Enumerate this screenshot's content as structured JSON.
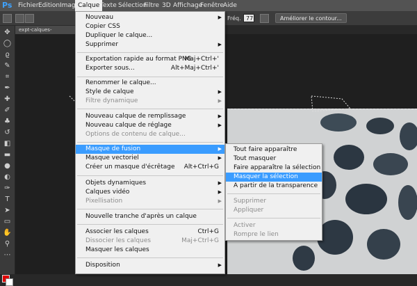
{
  "app": {
    "logo": "Ps"
  },
  "menubar": {
    "items": [
      "Fichier",
      "Edition",
      "Image",
      "Calque",
      "Texte",
      "Sélection",
      "Filtre",
      "3D",
      "Affichage",
      "Fenêtre",
      "Aide"
    ],
    "active": "Calque"
  },
  "options_bar": {
    "freq_label": "Fréq. :",
    "freq_value": "77",
    "refine_button": "Améliorer le contour..."
  },
  "document": {
    "tab_title": "expt-calques-arrivee.psd @"
  },
  "calque_menu": {
    "items": [
      {
        "label": "Nouveau",
        "shortcut": "",
        "submenu": true,
        "disabled": false
      },
      {
        "label": "Copier CSS",
        "shortcut": "",
        "submenu": false,
        "disabled": false
      },
      {
        "label": "Dupliquer le calque...",
        "shortcut": "",
        "submenu": false,
        "disabled": false
      },
      {
        "label": "Supprimer",
        "shortcut": "",
        "submenu": true,
        "disabled": false
      },
      {
        "label": "Exportation rapide au format PNG",
        "shortcut": "Maj+Ctrl+'",
        "submenu": false,
        "disabled": false
      },
      {
        "label": "Exporter sous...",
        "shortcut": "Alt+Maj+Ctrl+'",
        "submenu": false,
        "disabled": false
      },
      {
        "label": "Renommer le calque...",
        "shortcut": "",
        "submenu": false,
        "disabled": false
      },
      {
        "label": "Style de calque",
        "shortcut": "",
        "submenu": true,
        "disabled": false
      },
      {
        "label": "Filtre dynamique",
        "shortcut": "",
        "submenu": true,
        "disabled": true
      },
      {
        "label": "Nouveau calque de remplissage",
        "shortcut": "",
        "submenu": true,
        "disabled": false
      },
      {
        "label": "Nouveau calque de réglage",
        "shortcut": "",
        "submenu": true,
        "disabled": false
      },
      {
        "label": "Options de contenu de calque...",
        "shortcut": "",
        "submenu": false,
        "disabled": true
      },
      {
        "label": "Masque de fusion",
        "shortcut": "",
        "submenu": true,
        "disabled": false,
        "highlighted": true
      },
      {
        "label": "Masque vectoriel",
        "shortcut": "",
        "submenu": true,
        "disabled": false
      },
      {
        "label": "Créer un masque d'écrêtage",
        "shortcut": "Alt+Ctrl+G",
        "submenu": false,
        "disabled": false
      },
      {
        "label": "Objets dynamiques",
        "shortcut": "",
        "submenu": true,
        "disabled": false
      },
      {
        "label": "Calques vidéo",
        "shortcut": "",
        "submenu": true,
        "disabled": false
      },
      {
        "label": "Pixellisation",
        "shortcut": "",
        "submenu": true,
        "disabled": true
      },
      {
        "label": "Nouvelle tranche d'après un calque",
        "shortcut": "",
        "submenu": false,
        "disabled": false
      },
      {
        "label": "Associer les calques",
        "shortcut": "Ctrl+G",
        "submenu": false,
        "disabled": false
      },
      {
        "label": "Dissocier les calques",
        "shortcut": "Maj+Ctrl+G",
        "submenu": false,
        "disabled": true
      },
      {
        "label": "Masquer les calques",
        "shortcut": "",
        "submenu": false,
        "disabled": false
      },
      {
        "label": "Disposition",
        "shortcut": "",
        "submenu": true,
        "disabled": false
      }
    ]
  },
  "mask_submenu": {
    "items": [
      {
        "label": "Tout faire apparaître",
        "disabled": false
      },
      {
        "label": "Tout masquer",
        "disabled": false
      },
      {
        "label": "Faire apparaître la sélection",
        "disabled": false
      },
      {
        "label": "Masquer la sélection",
        "disabled": false,
        "highlighted": true
      },
      {
        "label": "A partir de la transparence",
        "disabled": false
      },
      {
        "label": "Supprimer",
        "disabled": true
      },
      {
        "label": "Appliquer",
        "disabled": true
      },
      {
        "label": "Activer",
        "disabled": true
      },
      {
        "label": "Rompre le lien",
        "disabled": true
      }
    ]
  },
  "colors": {
    "highlight": "#3a9cff",
    "foreground": "#e00000",
    "background": "#ffffff"
  }
}
